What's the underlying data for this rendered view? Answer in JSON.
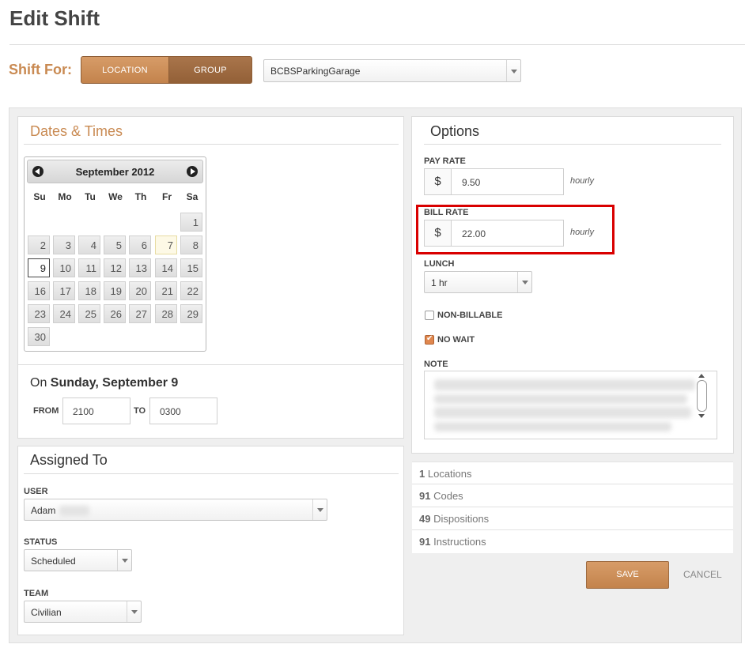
{
  "page_title": "Edit Shift",
  "shift_for": {
    "label": "Shift For:",
    "location_label": "LOCATION",
    "group_label": "GROUP",
    "selected_value": "BCBSParkingGarage"
  },
  "dates_times": {
    "heading": "Dates & Times",
    "calendar": {
      "month_label": "September 2012",
      "weekdays": [
        "Su",
        "Mo",
        "Tu",
        "We",
        "Th",
        "Fr",
        "Sa"
      ],
      "days": [
        "1",
        "2",
        "3",
        "4",
        "5",
        "6",
        "7",
        "8",
        "9",
        "10",
        "11",
        "12",
        "13",
        "14",
        "15",
        "16",
        "17",
        "18",
        "19",
        "20",
        "21",
        "22",
        "23",
        "24",
        "25",
        "26",
        "27",
        "28",
        "29",
        "30"
      ],
      "today": "7",
      "selected": "9"
    },
    "on_prefix": "On",
    "on_date": "Sunday, September 9",
    "from_label": "FROM",
    "from_value": "2100",
    "to_label": "TO",
    "to_value": "0300"
  },
  "assigned_to": {
    "heading": "Assigned To",
    "user_label": "USER",
    "user_value": "Adam",
    "status_label": "STATUS",
    "status_value": "Scheduled",
    "team_label": "TEAM",
    "team_value": "Civilian"
  },
  "options": {
    "heading": "Options",
    "pay_rate_label": "PAY RATE",
    "pay_rate_currency": "$",
    "pay_rate_value": "9.50",
    "pay_rate_unit": "hourly",
    "bill_rate_label": "BILL RATE",
    "bill_rate_currency": "$",
    "bill_rate_value": "22.00",
    "bill_rate_unit": "hourly",
    "lunch_label": "LUNCH",
    "lunch_value": "1 hr",
    "non_billable_label": "NON-BILLABLE",
    "non_billable_checked": false,
    "no_wait_label": "NO WAIT",
    "no_wait_checked": true,
    "note_label": "NOTE"
  },
  "stats": [
    {
      "count": "1",
      "label": "Locations"
    },
    {
      "count": "91",
      "label": "Codes"
    },
    {
      "count": "49",
      "label": "Dispositions"
    },
    {
      "count": "91",
      "label": "Instructions"
    }
  ],
  "actions": {
    "save_label": "SAVE",
    "cancel_label": "CANCEL"
  },
  "colors": {
    "accent": "#c98a52",
    "highlight_border": "#d90000"
  }
}
